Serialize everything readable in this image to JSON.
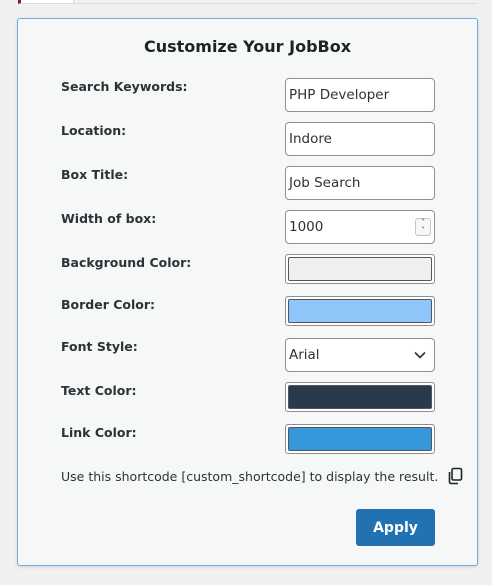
{
  "form": {
    "title": "Customize Your JobBox",
    "rows": {
      "keywords": {
        "label": "Search Keywords:",
        "value": "PHP Developer"
      },
      "location": {
        "label": "Location:",
        "value": "Indore"
      },
      "box_title": {
        "label": "Box Title:",
        "value": "Job Search"
      },
      "width": {
        "label": "Width of box:",
        "value": "1000"
      },
      "bg_color": {
        "label": "Background Color:",
        "color": "#f0f0f1"
      },
      "border_color": {
        "label": "Border Color:",
        "color": "#90c5f9"
      },
      "font_style": {
        "label": "Font Style:",
        "value": "Arial"
      },
      "text_color": {
        "label": "Text Color:",
        "color": "#2b3a4a"
      },
      "link_color": {
        "label": "Link Color:",
        "color": "#3498db"
      }
    },
    "shortcode_text": "Use this shortcode [custom_shortcode] to display the result.",
    "apply_label": "Apply"
  },
  "theme": {
    "accent": "#2271b1",
    "panel_border": "#72aee6",
    "top_tab_accent": "#8c1b3a"
  }
}
